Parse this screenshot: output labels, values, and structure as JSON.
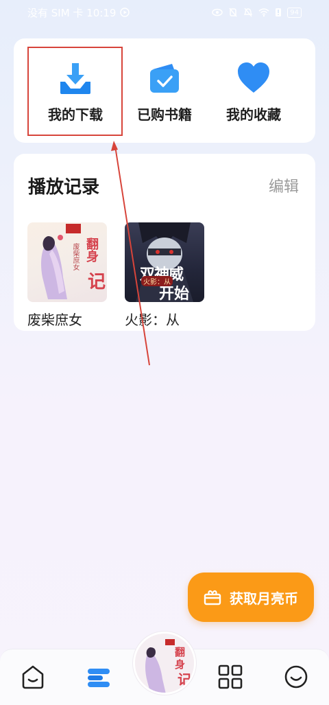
{
  "status_bar": {
    "left_text": "没有 SIM 卡 10:19",
    "battery": "94"
  },
  "quick_actions": [
    {
      "label": "我的下载",
      "icon": "download-icon"
    },
    {
      "label": "已购书籍",
      "icon": "purchased-books-icon"
    },
    {
      "label": "我的收藏",
      "icon": "heart-icon"
    }
  ],
  "history": {
    "title": "播放记录",
    "edit_label": "编辑",
    "books": [
      {
        "title": "废柴庶女",
        "cover_text_a": "翻身",
        "cover_text_b": "记",
        "cover_sub": "废柴庶女"
      },
      {
        "title": "火影：从",
        "cover_text_a": "双神威",
        "cover_text_b": "开始",
        "cover_sub": "火影：从"
      }
    ]
  },
  "fab": {
    "label": "获取月亮币",
    "icon": "gift-box-icon"
  },
  "bottom_nav": [
    {
      "name": "home-icon"
    },
    {
      "name": "bookshelf-icon"
    },
    {
      "name": "now-playing-disc"
    },
    {
      "name": "apps-grid-icon"
    },
    {
      "name": "profile-smile-icon"
    }
  ],
  "colors": {
    "accent_blue": "#2f8df4",
    "fab_orange": "#fb9a17",
    "annotation_red": "#d7443a"
  }
}
